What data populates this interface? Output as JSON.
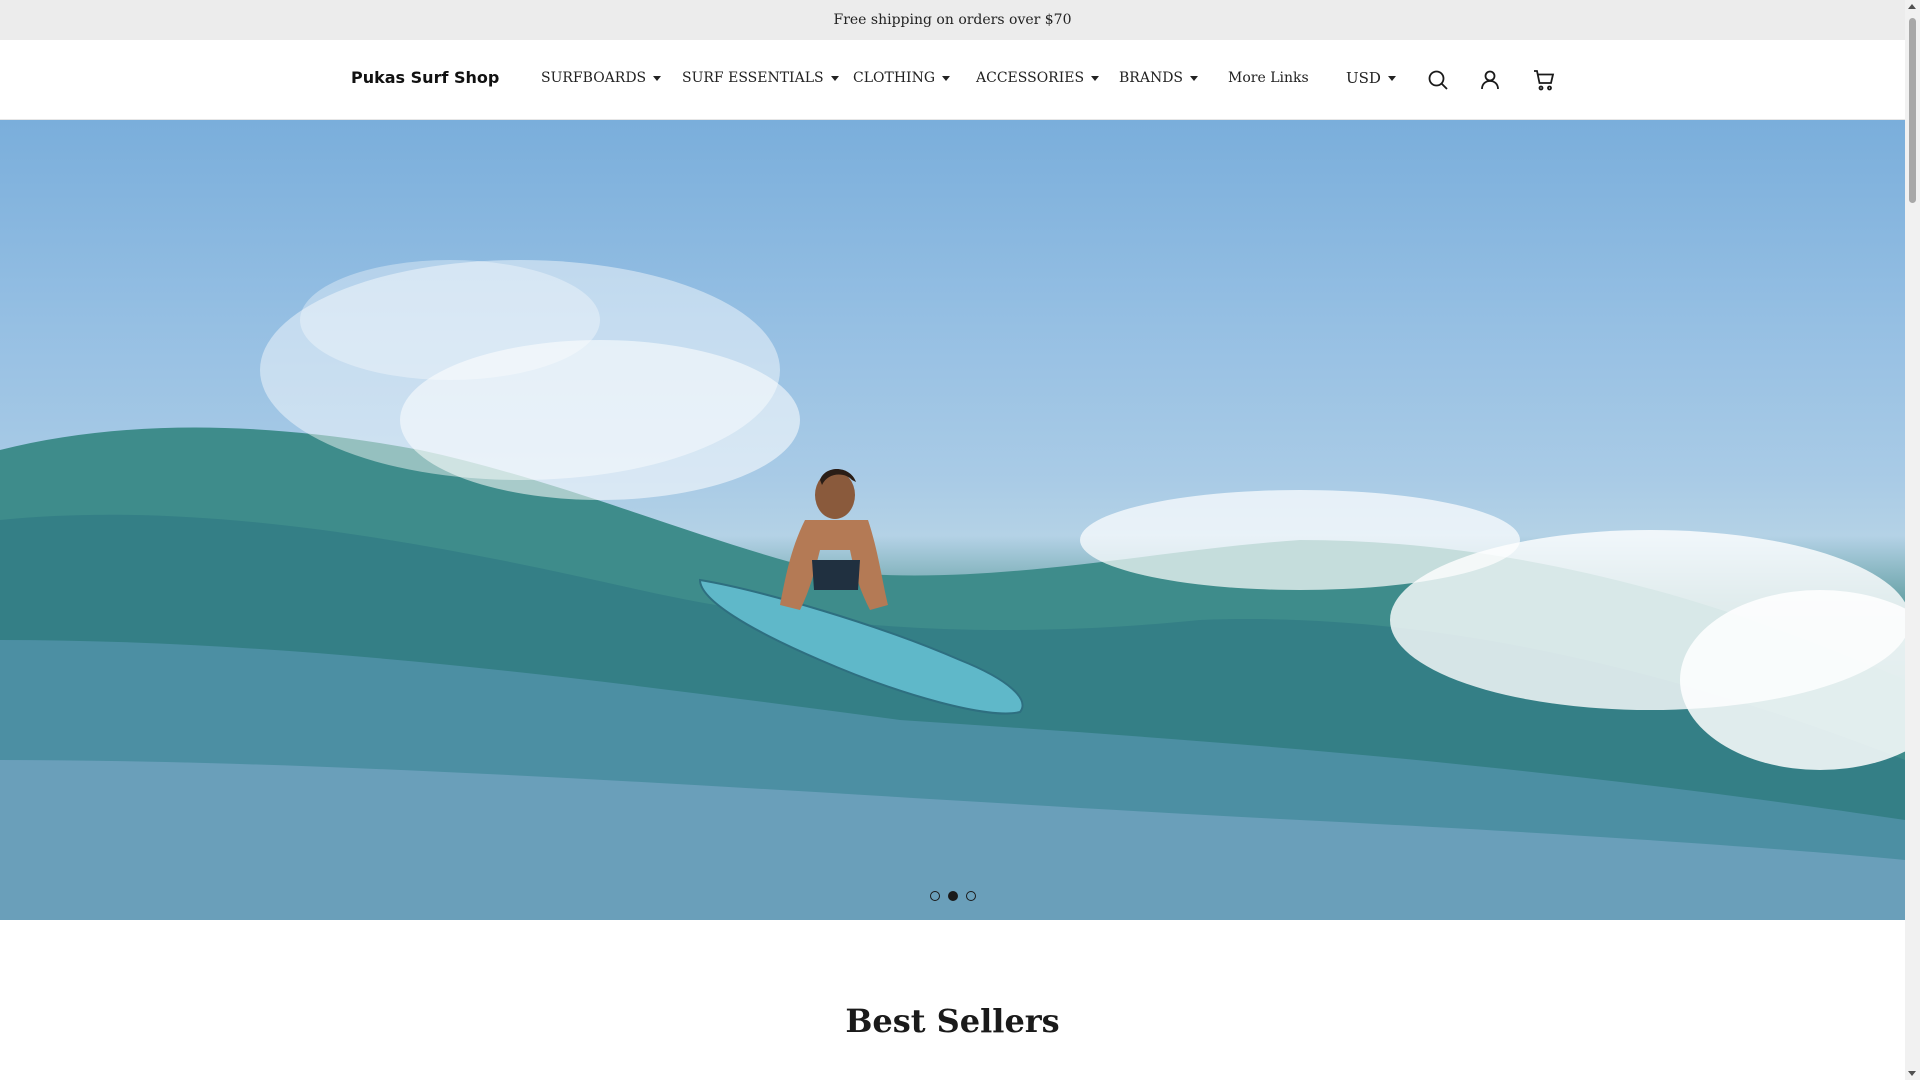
{
  "announcement": {
    "text": "Free shipping on orders over $70"
  },
  "header": {
    "logo": "Pukas Surf Shop",
    "nav": [
      {
        "label": "SURFBOARDS",
        "has_dropdown": true
      },
      {
        "label": "SURF ESSENTIALS",
        "has_dropdown": true
      },
      {
        "label": "CLOTHING",
        "has_dropdown": true
      },
      {
        "label": "ACCESSORIES",
        "has_dropdown": true
      },
      {
        "label": "BRANDS",
        "has_dropdown": true
      },
      {
        "label": "More Links",
        "has_dropdown": false
      }
    ],
    "currency": "USD",
    "icons": [
      "search-icon",
      "account-icon",
      "cart-icon"
    ]
  },
  "hero": {
    "image": "surfer-riding-wave",
    "slides_total": 3,
    "active_slide": 2
  },
  "best_sellers": {
    "title": "Best Sellers"
  },
  "colors": {
    "announcement_bg": "#ececec",
    "text": "#1a1a1a",
    "page_bg": "#ffffff"
  }
}
